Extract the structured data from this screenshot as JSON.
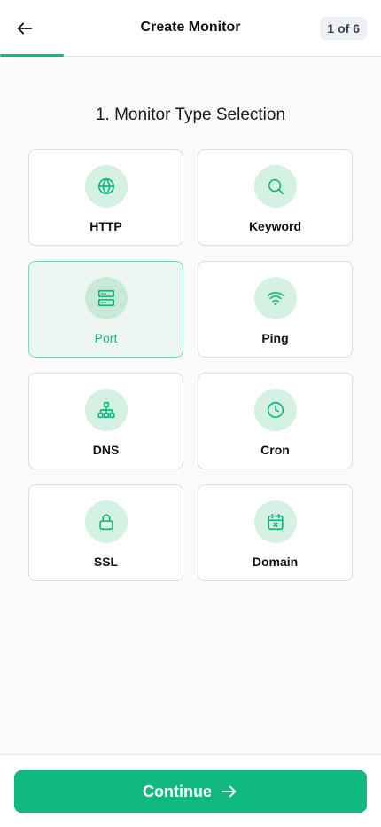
{
  "header": {
    "title": "Create Monitor",
    "step_badge": "1 of 6",
    "progress": 0.167
  },
  "section": {
    "title": "1. Monitor Type Selection"
  },
  "monitor_types": [
    {
      "label": "HTTP",
      "icon": "globe-icon",
      "selected": false
    },
    {
      "label": "Keyword",
      "icon": "search-icon",
      "selected": false
    },
    {
      "label": "Port",
      "icon": "server-icon",
      "selected": true
    },
    {
      "label": "Ping",
      "icon": "wifi-icon",
      "selected": false
    },
    {
      "label": "DNS",
      "icon": "network-icon",
      "selected": false
    },
    {
      "label": "Cron",
      "icon": "clock-icon",
      "selected": false
    },
    {
      "label": "SSL",
      "icon": "lock-icon",
      "selected": false
    },
    {
      "label": "Domain",
      "icon": "calendar-x-icon",
      "selected": false
    }
  ],
  "footer": {
    "continue_label": "Continue"
  },
  "colors": {
    "accent": "#10b981",
    "icon_bg": "#d4f1e4",
    "selected_bg": "#eef6f2"
  }
}
